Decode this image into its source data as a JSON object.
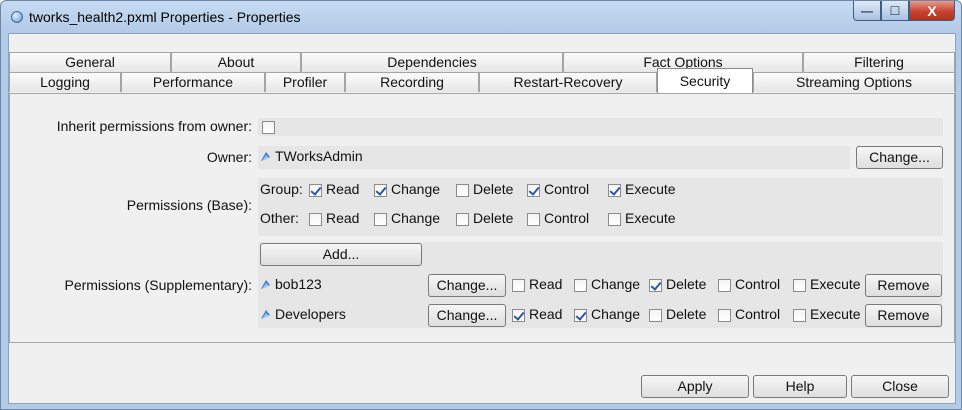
{
  "window": {
    "title": "tworks_health2.pxml Properties - Properties",
    "controls": {
      "minimize": "—",
      "maximize": "☐",
      "close": "X"
    }
  },
  "tabs": {
    "row1": [
      "General",
      "About",
      "Dependencies",
      "Fact Options",
      "Filtering"
    ],
    "row2": [
      "Logging",
      "Performance",
      "Profiler",
      "Recording",
      "Restart-Recovery",
      "Security",
      "Streaming Options"
    ],
    "selected": "Security"
  },
  "security": {
    "inherit": {
      "label": "Inherit permissions from owner:",
      "checked": false
    },
    "owner": {
      "label": "Owner:",
      "value": "TWorksAdmin",
      "change_label": "Change..."
    },
    "base": {
      "label": "Permissions (Base):",
      "group_label": "Group:",
      "other_label": "Other:",
      "perm_names": [
        "Read",
        "Change",
        "Delete",
        "Control",
        "Execute"
      ],
      "group": [
        true,
        true,
        false,
        true,
        true
      ],
      "other": [
        false,
        false,
        false,
        false,
        false
      ]
    },
    "supplementary": {
      "label": "Permissions (Supplementary):",
      "add_label": "Add...",
      "change_label": "Change...",
      "remove_label": "Remove",
      "perm_names": [
        "Read",
        "Change",
        "Delete",
        "Control",
        "Execute"
      ],
      "entries": [
        {
          "name": "bob123",
          "perms": [
            false,
            false,
            true,
            false,
            false
          ]
        },
        {
          "name": "Developers",
          "perms": [
            true,
            true,
            false,
            false,
            false
          ]
        }
      ]
    }
  },
  "footer": {
    "apply": "Apply",
    "help": "Help",
    "close": "Close"
  }
}
